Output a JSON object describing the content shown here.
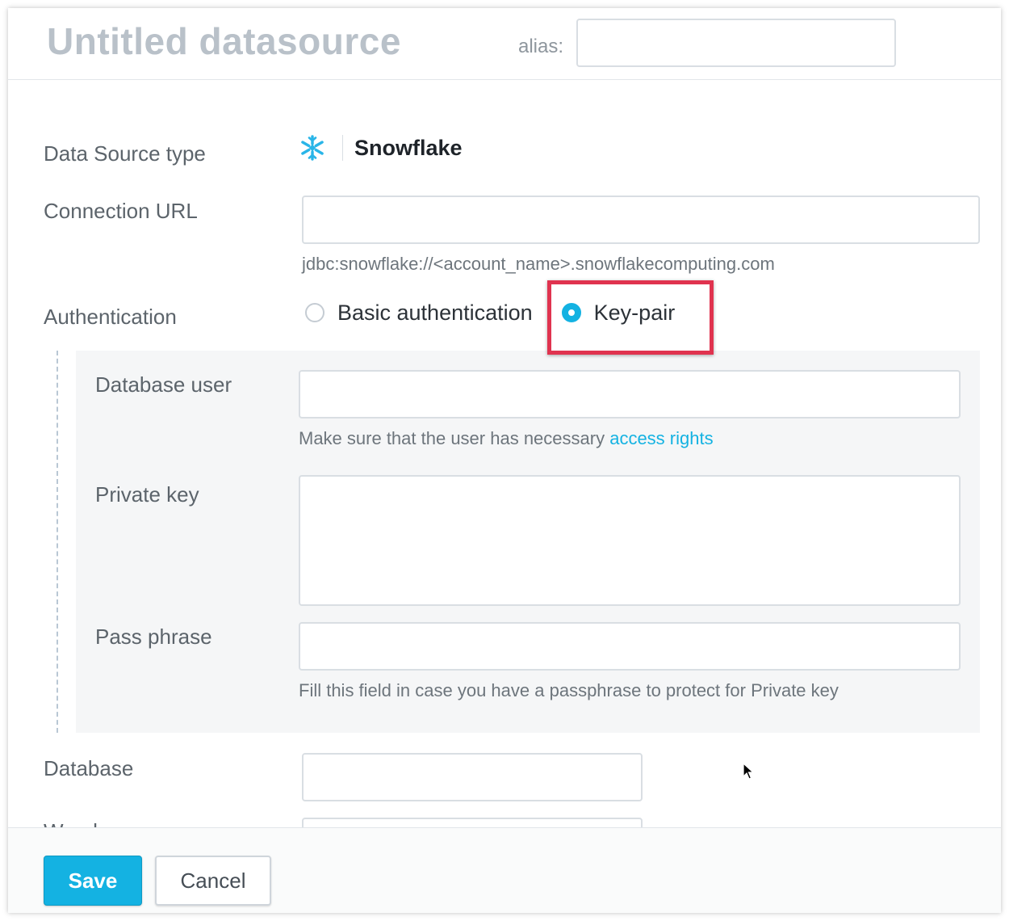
{
  "header": {
    "title": "Untitled datasource",
    "alias_label": "alias:",
    "alias_value": ""
  },
  "form": {
    "data_source_type": {
      "label": "Data Source type",
      "value": "Snowflake",
      "icon": "snowflake-icon",
      "icon_color": "#29b5e8"
    },
    "connection_url": {
      "label": "Connection URL",
      "value": "",
      "hint": "jdbc:snowflake://<account_name>.snowflakecomputing.com"
    },
    "authentication": {
      "label": "Authentication",
      "options": [
        {
          "label": "Basic authentication",
          "checked": false
        },
        {
          "label": "Key-pair",
          "checked": true
        }
      ],
      "highlight_color": "#e0334f"
    },
    "database_user": {
      "label": "Database user",
      "value": "",
      "hint_text": "Make sure that the user has necessary ",
      "hint_link": "access rights"
    },
    "private_key": {
      "label": "Private key",
      "value": ""
    },
    "pass_phrase": {
      "label": "Pass phrase",
      "value": "",
      "hint": "Fill this field in case you have a passphrase to protect for Private key"
    },
    "database": {
      "label": "Database",
      "value": ""
    },
    "warehouse": {
      "label": "Warehouse",
      "value": ""
    }
  },
  "footer": {
    "save_label": "Save",
    "cancel_label": "Cancel"
  },
  "colors": {
    "accent": "#14b2e2"
  }
}
